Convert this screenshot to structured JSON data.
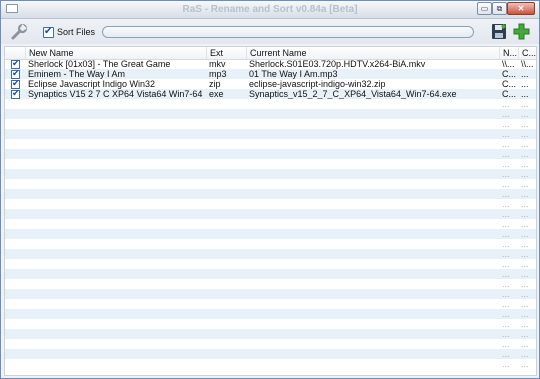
{
  "window": {
    "title": "RaS - Rename and Sort v0.84a [Beta]",
    "min_label": "▭",
    "max_label": "⧉",
    "close_label": "✕"
  },
  "toolbar": {
    "sort_files_label": "Sort Files",
    "sort_files_checked": true,
    "progress": 0,
    "settings_icon": "wrench-icon",
    "save_icon": "save-icon",
    "add_icon": "add-icon"
  },
  "table": {
    "columns": [
      "New Name",
      "Ext",
      "Current Name",
      "N...",
      "C..."
    ],
    "rows": [
      {
        "checked": true,
        "new_name": "Sherlock [01x03] - The Great Game",
        "ext": "mkv",
        "current_name": "Sherlock.S01E03.720p.HDTV.x264-BiA.mkv",
        "n": "\\\\...",
        "c": "\\\\..."
      },
      {
        "checked": true,
        "new_name": "Eminem - The Way I Am",
        "ext": "mp3",
        "current_name": "01 The Way I Am.mp3",
        "n": "C...",
        "c": "..."
      },
      {
        "checked": true,
        "new_name": "Eclipse Javascript Indigo Win32",
        "ext": "zip",
        "current_name": "eclipse-javascript-indigo-win32.zip",
        "n": "C...",
        "c": "..."
      },
      {
        "checked": true,
        "new_name": "Synaptics V15 2 7 C XP64 Vista64 Win7-64",
        "ext": "exe",
        "current_name": "Synaptics_v15_2_7_C_XP64_Vista64_Win7-64.exe",
        "n": "C...",
        "c": "..."
      }
    ],
    "empty_cell": "..."
  }
}
